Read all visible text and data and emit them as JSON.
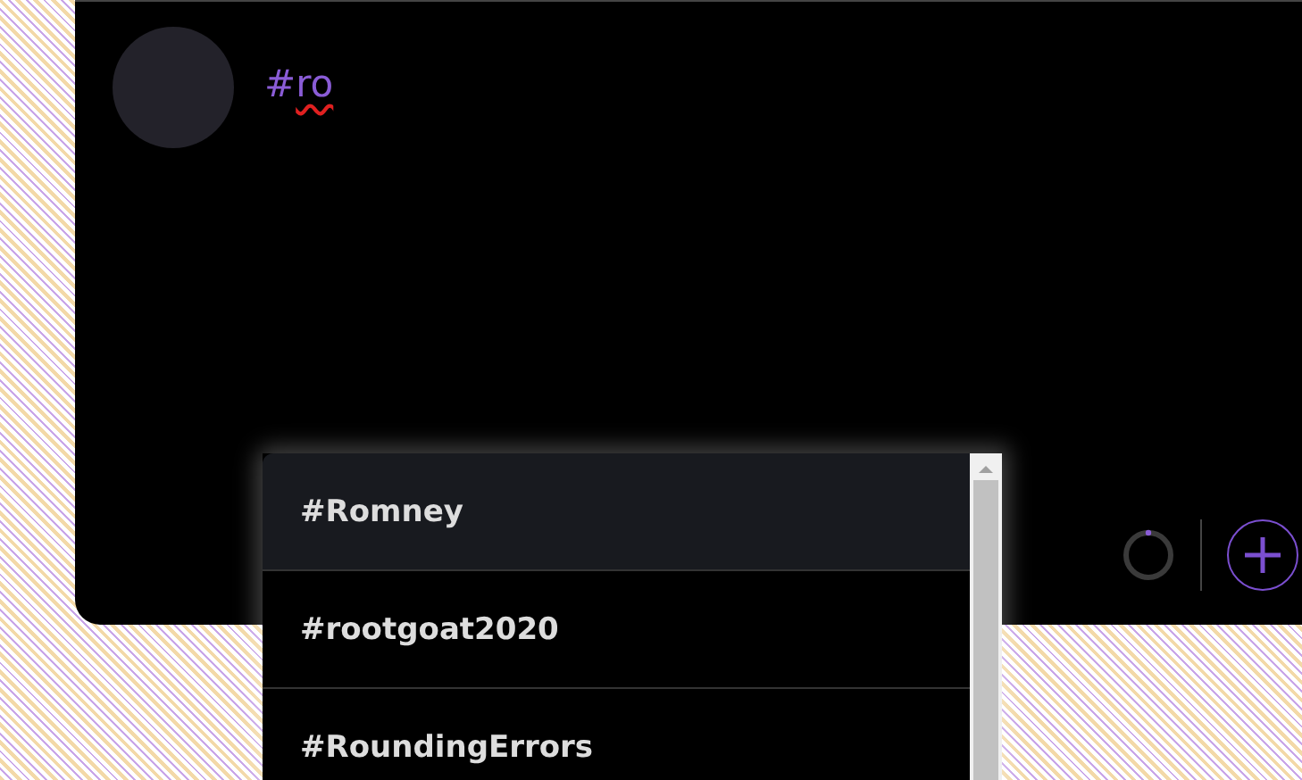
{
  "composer": {
    "text": "#ro",
    "misspelled": true
  },
  "suggestions": [
    {
      "label": "#Romney",
      "selected": true
    },
    {
      "label": "#rootgoat2020",
      "selected": false
    },
    {
      "label": "#RoundingErrors",
      "selected": false
    }
  ]
}
